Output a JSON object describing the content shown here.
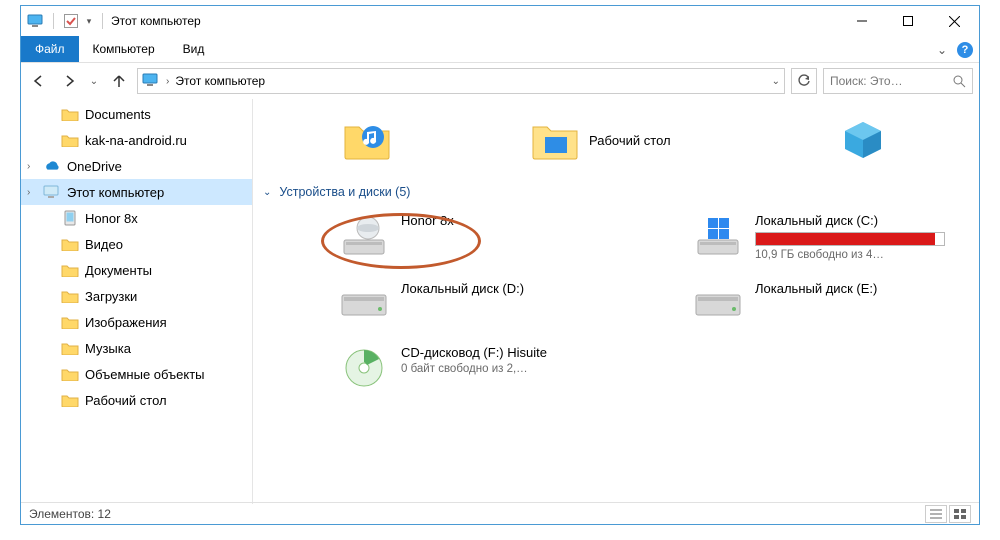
{
  "colors": {
    "accent": "#1979ca",
    "border": "#4a9ad4",
    "diskRed": "#da1919"
  },
  "title": "Этот компьютер",
  "ribbon": {
    "file": "Файл",
    "tabs": [
      "Компьютер",
      "Вид"
    ]
  },
  "breadcrumb": {
    "root": "Этот компьютер"
  },
  "search": {
    "placeholder": "Поиск: Это…"
  },
  "sidebar": {
    "items": [
      {
        "label": "Documents",
        "icon": "folder",
        "level": 2
      },
      {
        "label": "kak-na-android.ru",
        "icon": "folder",
        "level": 2
      },
      {
        "label": "OneDrive",
        "icon": "onedrive",
        "level": 1,
        "caret": true
      },
      {
        "label": "Этот компьютер",
        "icon": "computer",
        "level": 1,
        "caret": true,
        "selected": true
      },
      {
        "label": "Honor 8x",
        "icon": "phone",
        "level": 2
      },
      {
        "label": "Видео",
        "icon": "folder-video",
        "level": 2
      },
      {
        "label": "Документы",
        "icon": "folder-doc",
        "level": 2
      },
      {
        "label": "Загрузки",
        "icon": "folder-down",
        "level": 2
      },
      {
        "label": "Изображения",
        "icon": "folder-img",
        "level": 2
      },
      {
        "label": "Музыка",
        "icon": "folder-music",
        "level": 2
      },
      {
        "label": "Объемные объекты",
        "icon": "folder-3d",
        "level": 2
      },
      {
        "label": "Рабочий стол",
        "icon": "folder-desk",
        "level": 2
      }
    ]
  },
  "topTiles": {
    "music": {
      "label": ""
    },
    "desktop": {
      "label": "Рабочий стол"
    },
    "cube": {
      "label": ""
    }
  },
  "section": {
    "title": "Устройства и диски (5)"
  },
  "devices": [
    {
      "name": "Honor 8x",
      "icon": "phone-drive",
      "highlight": true
    },
    {
      "name": "Локальный диск (C:)",
      "icon": "win-drive",
      "bar": 0.95,
      "sub": "10,9 ГБ свободно из 4…"
    },
    {
      "name": "Локальный диск (D:)",
      "icon": "drive"
    },
    {
      "name": "Локальный диск (E:)",
      "icon": "drive"
    },
    {
      "name": "CD-дисковод (F:) Hisuite",
      "icon": "cd",
      "sub": "0 байт свободно из 2,…"
    }
  ],
  "status": {
    "count_label": "Элементов: 12"
  }
}
